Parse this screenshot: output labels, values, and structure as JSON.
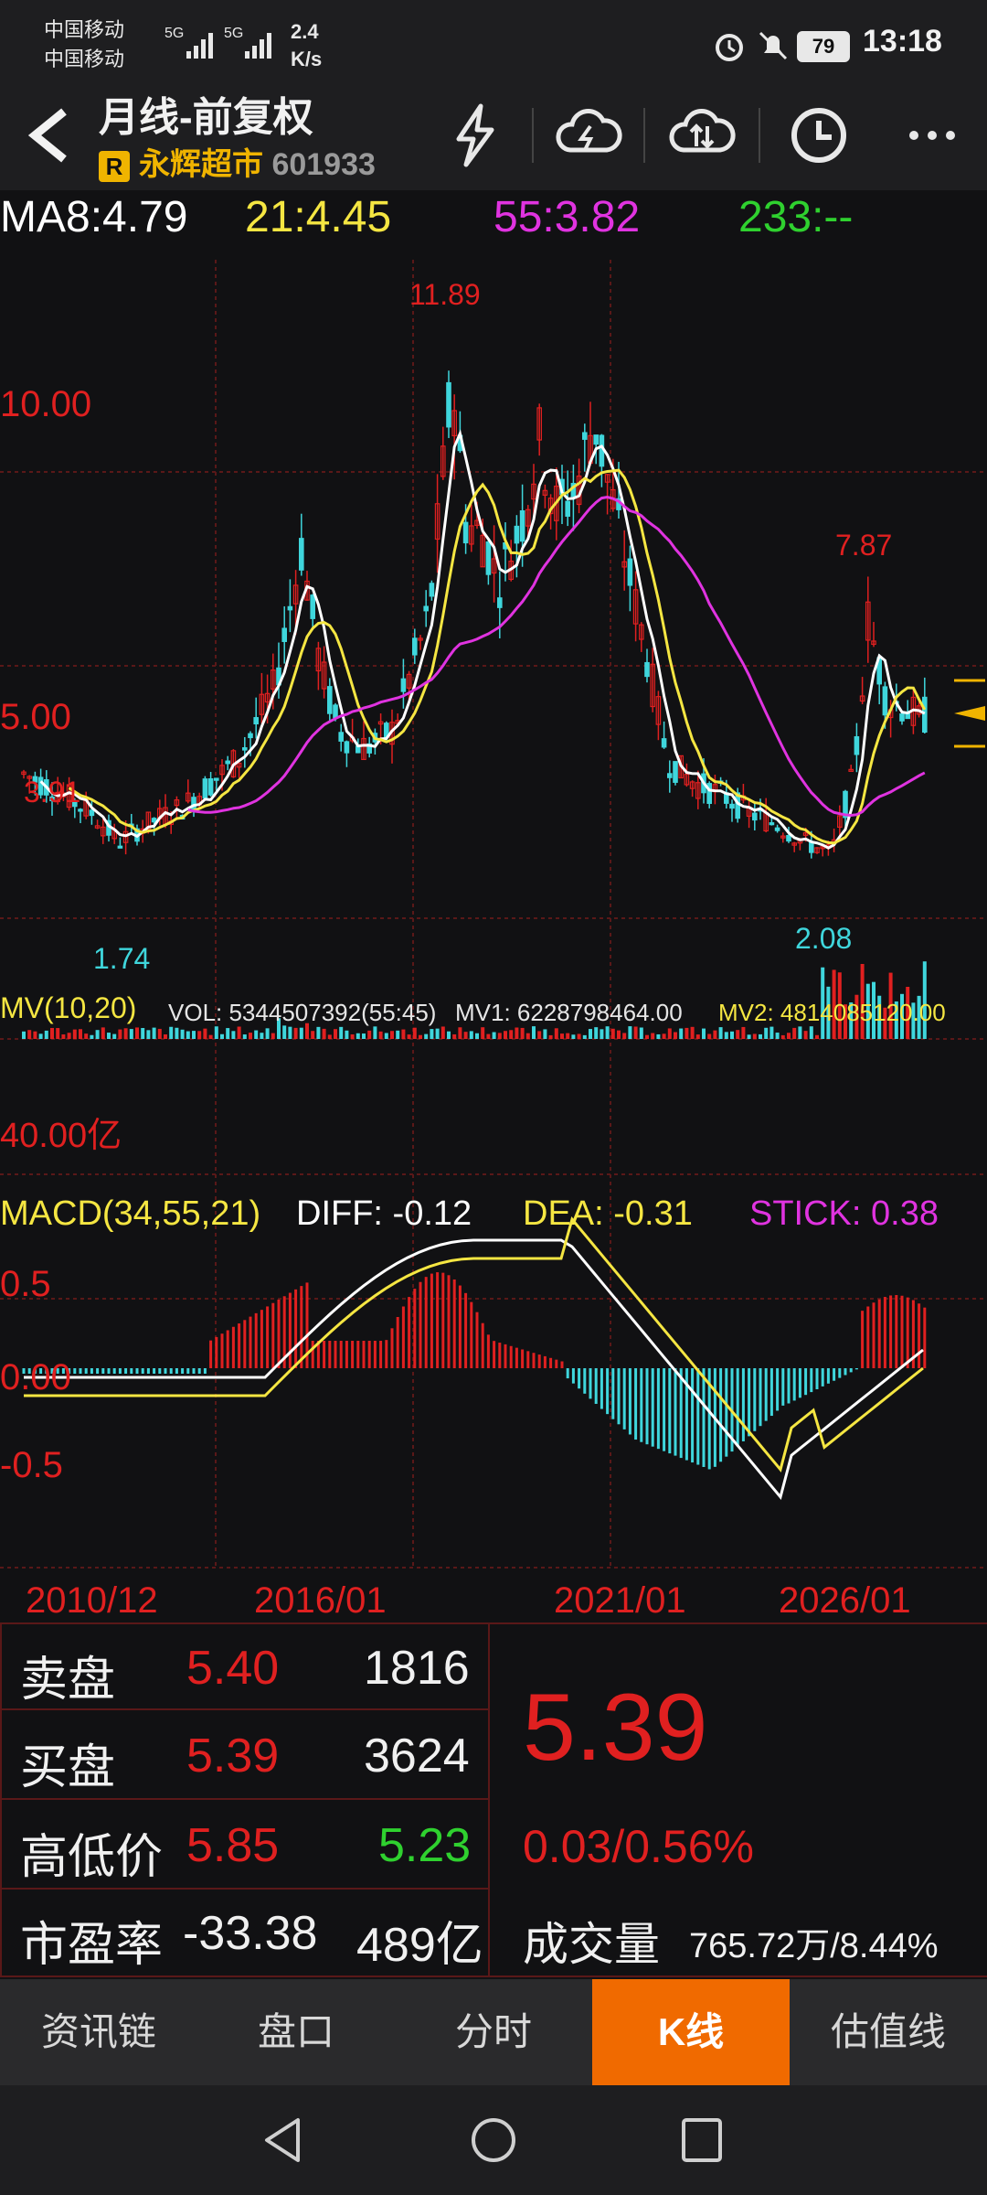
{
  "status": {
    "carrier1": "中国移动",
    "carrier2": "中国移动",
    "net1": "5G",
    "net2": "5G",
    "speed_val": "2.4",
    "speed_unit": "K/s",
    "battery": "79",
    "time": "13:18"
  },
  "header": {
    "title": "月线-前复权",
    "badge": "R",
    "stock_name": "永辉超市",
    "stock_code": "601933"
  },
  "ma": {
    "ma8": "MA8:4.79",
    "ma21": "21:4.45",
    "ma55": "55:3.82",
    "ma233": "233:--"
  },
  "price_axis": {
    "high_label": "10.00",
    "mid_label": "5.00",
    "max_mark": "11.89",
    "left_mark": "3.91",
    "min_mark": "1.74",
    "right_high": "7.87",
    "right_low": "2.08"
  },
  "volume": {
    "name": "MV(10,20)",
    "vol": "VOL: 5344507392(55:45)",
    "mv1": "MV1: 6228798464.00",
    "mv2": "MV2: 4814085120.00",
    "axis": "40.00亿"
  },
  "macd": {
    "name": "MACD(34,55,21)",
    "diff": "DIFF: -0.12",
    "dea": "DEA: -0.31",
    "stick": "STICK: 0.38",
    "tick_pos": "0.5",
    "tick_zero": "0.00",
    "tick_neg": "-0.5"
  },
  "dates": [
    "2010/12",
    "2016/01",
    "2021/01",
    "2026/01"
  ],
  "quote": {
    "sell_label": "卖盘",
    "sell_price": "5.40",
    "sell_vol": "1816",
    "buy_label": "买盘",
    "buy_price": "5.39",
    "buy_vol": "3624",
    "hl_label": "高低价",
    "high": "5.85",
    "low": "5.23",
    "pe_label": "市盈率",
    "pe": "-33.38",
    "mktcap": "489亿",
    "last": "5.39",
    "change": "0.03/0.56%",
    "turnover_label": "成交量",
    "turnover": "765.72万/8.44%"
  },
  "tabs": [
    "资讯链",
    "盘口",
    "分时",
    "K线",
    "估值线"
  ],
  "colors": {
    "up": "#e02020",
    "down": "#3fd6dc",
    "ma8": "#ffffff",
    "ma21": "#f5e642",
    "ma55": "#e033e0",
    "active_tab": "#f06a00"
  }
}
